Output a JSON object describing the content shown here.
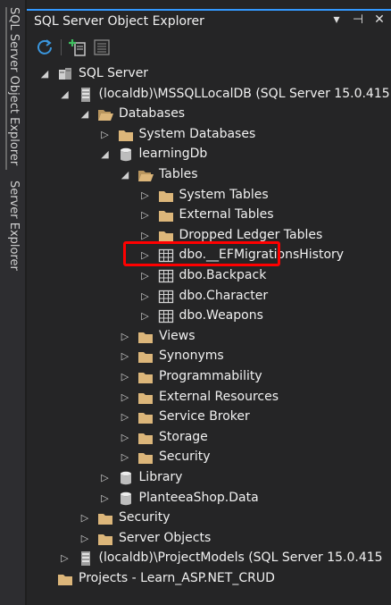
{
  "sidebar": {
    "tabs": [
      "SQL Server Object Explorer",
      "Server Explorer"
    ]
  },
  "panel": {
    "title": "SQL Server Object Explorer",
    "buttons": {
      "dropdown": "▾",
      "pin": "⊣",
      "close": "✕"
    }
  },
  "toolbar": {
    "refresh_icon": "refresh-icon",
    "add_server_icon": "add-server-icon",
    "filter_icon": "filter-icon"
  },
  "tree": [
    {
      "label": "SQL Server",
      "icon": "sql-server-icon",
      "state": "expanded"
    },
    {
      "label": "(localdb)\\MSSQLLocalDB (SQL Server 15.0.415",
      "icon": "server-icon",
      "state": "expanded"
    },
    {
      "label": "Databases",
      "icon": "folder-open-icon",
      "state": "expanded"
    },
    {
      "label": "System Databases",
      "icon": "folder-icon",
      "state": "collapsed"
    },
    {
      "label": "learningDb",
      "icon": "database-icon",
      "state": "expanded"
    },
    {
      "label": "Tables",
      "icon": "folder-open-icon",
      "state": "expanded"
    },
    {
      "label": "System Tables",
      "icon": "folder-icon",
      "state": "collapsed"
    },
    {
      "label": "External Tables",
      "icon": "folder-icon",
      "state": "collapsed"
    },
    {
      "label": "Dropped Ledger Tables",
      "icon": "folder-icon",
      "state": "collapsed"
    },
    {
      "label": "dbo.__EFMigrationsHistory",
      "icon": "table-icon",
      "state": "collapsed"
    },
    {
      "label": "dbo.Backpack",
      "icon": "table-icon",
      "state": "collapsed"
    },
    {
      "label": "dbo.Character",
      "icon": "table-icon",
      "state": "collapsed"
    },
    {
      "label": "dbo.Weapons",
      "icon": "table-icon",
      "state": "collapsed"
    },
    {
      "label": "Views",
      "icon": "folder-icon",
      "state": "collapsed"
    },
    {
      "label": "Synonyms",
      "icon": "folder-icon",
      "state": "collapsed"
    },
    {
      "label": "Programmability",
      "icon": "folder-icon",
      "state": "collapsed"
    },
    {
      "label": "External Resources",
      "icon": "folder-icon",
      "state": "collapsed"
    },
    {
      "label": "Service Broker",
      "icon": "folder-icon",
      "state": "collapsed"
    },
    {
      "label": "Storage",
      "icon": "folder-icon",
      "state": "collapsed"
    },
    {
      "label": "Security",
      "icon": "folder-icon",
      "state": "collapsed"
    },
    {
      "label": "Library",
      "icon": "database-icon",
      "state": "collapsed"
    },
    {
      "label": "PlanteeaShop.Data",
      "icon": "database-icon",
      "state": "collapsed"
    },
    {
      "label": "Security",
      "icon": "folder-icon",
      "state": "collapsed"
    },
    {
      "label": "Server Objects",
      "icon": "folder-icon",
      "state": "collapsed"
    },
    {
      "label": "(localdb)\\ProjectModels (SQL Server 15.0.415",
      "icon": "server-icon",
      "state": "collapsed"
    },
    {
      "label": "Projects - Learn_ASP.NET_CRUD",
      "icon": "folder-icon",
      "state": "none"
    }
  ],
  "highlighted_item": "dbo.Weapons",
  "colors": {
    "background": "#252526",
    "folder": "#dcb67a",
    "highlight": "#ff0000",
    "accent": "#3399ff"
  }
}
